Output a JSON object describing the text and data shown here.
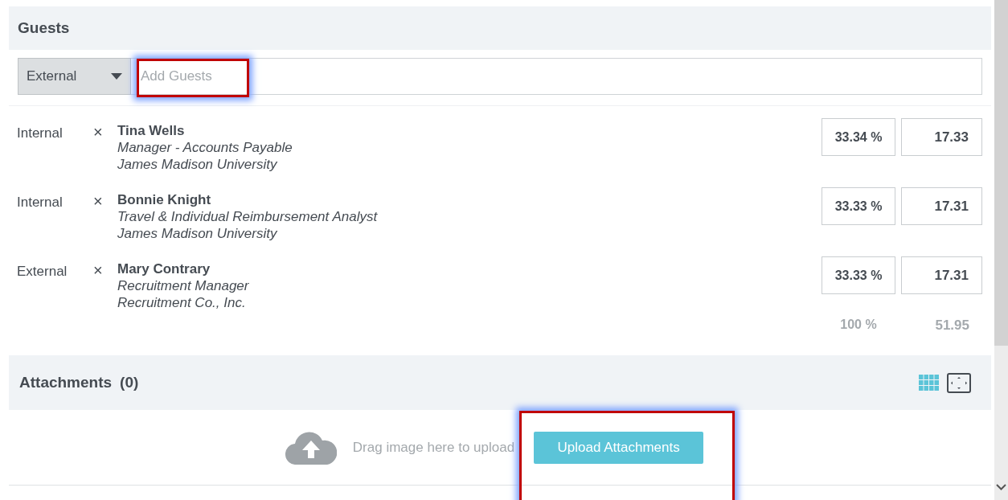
{
  "guests": {
    "title": "Guests",
    "type_select": "External",
    "add_field": {
      "placeholder": "Add Guests"
    },
    "rows": [
      {
        "type": "Internal",
        "remove": "×",
        "name": "Tina Wells",
        "title": "Manager - Accounts Payable",
        "org": "James Madison University",
        "percent": "33.34 %",
        "amount": "17.33"
      },
      {
        "type": "Internal",
        "remove": "×",
        "name": "Bonnie Knight",
        "title": "Travel & Individual Reimbursement Analyst",
        "org": "James Madison University",
        "percent": "33.33 %",
        "amount": "17.31"
      },
      {
        "type": "External",
        "remove": "×",
        "name": "Mary Contrary",
        "title": "Recruitment Manager",
        "org": "Recruitment Co., Inc.",
        "percent": "33.33 %",
        "amount": "17.31"
      }
    ],
    "total_percent": "100 %",
    "total_amount": "51.95"
  },
  "attachments": {
    "title": "Attachments",
    "count": "(0)",
    "drop_hint": "Drag image here to upload",
    "upload_button": "Upload Attachments"
  }
}
